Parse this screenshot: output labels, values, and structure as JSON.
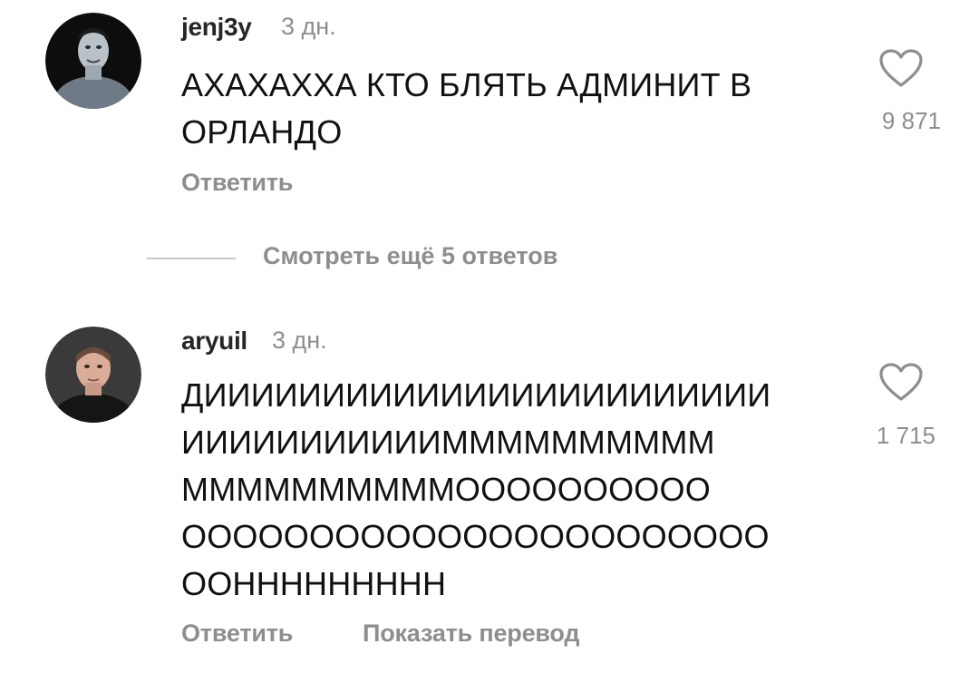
{
  "comments": [
    {
      "username": "jenj3y",
      "time": "3 дн.",
      "text": "АХАХАХХА КТО БЛЯТЬ АДМИНИТ В\nОРЛАНДО",
      "likes": "9 871",
      "reply_label": "Ответить",
      "avatar_icon": "avatar-man-dark"
    },
    {
      "username": "aryuil",
      "time": "3 дн.",
      "text": "ДИИИИИИИИИИИИИИИИИИИИИИИИ\nИИИИИИИИИИИММММММММММ\nММММММММММОООООООООО\nООООООООООООООООООООООО\nООННННННННН",
      "likes": "1 715",
      "reply_label": "Ответить",
      "translate_label": "Показать перевод",
      "avatar_icon": "avatar-man-black-shirt"
    }
  ],
  "view_more_replies": "Смотреть ещё 5 ответов",
  "colors": {
    "text": "#111111",
    "muted": "#8e8e8e",
    "username": "#262626"
  }
}
